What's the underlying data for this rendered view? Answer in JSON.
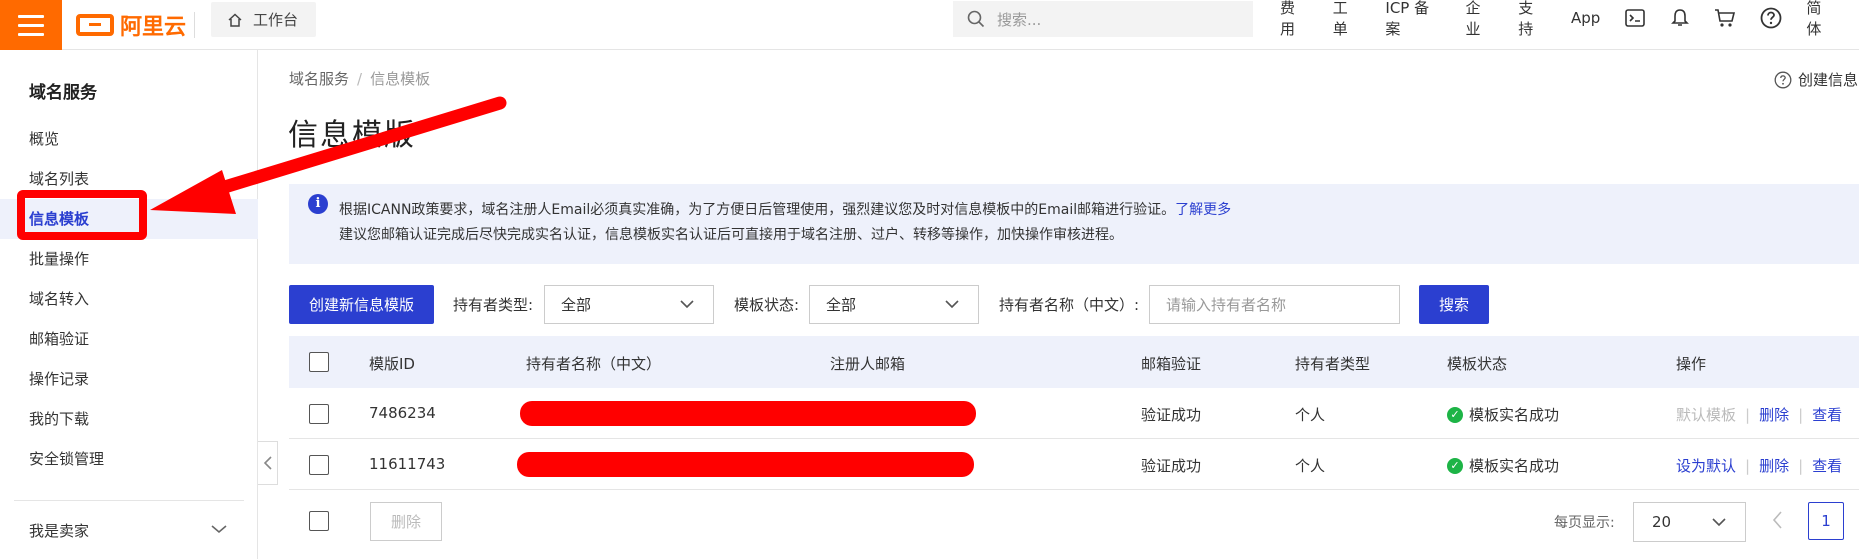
{
  "topbar": {
    "logo_text": "阿里云",
    "workbench_label": "工作台",
    "search_placeholder": "搜索...",
    "nav": [
      "费用",
      "工单",
      "ICP 备案",
      "企业",
      "支持",
      "App"
    ],
    "lang_label": "简体",
    "icons": [
      "terminal-icon",
      "bell-icon",
      "cart-icon",
      "help-icon"
    ]
  },
  "sidebar": {
    "title": "域名服务",
    "items": [
      {
        "label": "概览",
        "active": false
      },
      {
        "label": "域名列表",
        "active": false
      },
      {
        "label": "信息模板",
        "active": true
      },
      {
        "label": "批量操作",
        "active": false
      },
      {
        "label": "域名转入",
        "active": false
      },
      {
        "label": "邮箱验证",
        "active": false
      },
      {
        "label": "操作记录",
        "active": false
      },
      {
        "label": "我的下载",
        "active": false
      },
      {
        "label": "安全锁管理",
        "active": false
      }
    ],
    "seller_label": "我是卖家"
  },
  "breadcrumb": {
    "parent": "域名服务",
    "separator": "/",
    "current": "信息模板"
  },
  "help_link": "创建信息",
  "page_title": "信息模版",
  "notice": {
    "line1": "根据ICANN政策要求，域名注册人Email必须真实准确，为了方便日后管理使用，强烈建议您及时对信息模板中的Email邮箱进行验证。",
    "more_link": "了解更多",
    "line2": "建议您邮箱认证完成后尽快完成实名认证，信息模板实名认证后可直接用于域名注册、过户、转移等操作，加快操作审核进程。"
  },
  "filters": {
    "create_button": "创建新信息模版",
    "holder_type_label": "持有者类型:",
    "holder_type_value": "全部",
    "status_label": "模板状态:",
    "status_value": "全部",
    "holder_name_label": "持有者名称（中文）:",
    "holder_name_placeholder": "请输入持有者名称",
    "search_button": "搜索"
  },
  "table": {
    "columns": [
      "模版ID",
      "持有者名称（中文）",
      "注册人邮箱",
      "邮箱验证",
      "持有者类型",
      "模板状态",
      "操作"
    ],
    "rows": [
      {
        "id": "7486234",
        "email_verify": "验证成功",
        "holder_type": "个人",
        "status": "模板实名成功",
        "op_default": "默认模板",
        "op_default_enabled": false,
        "op_delete": "删除",
        "op_view": "查看"
      },
      {
        "id": "11611743",
        "email_verify": "验证成功",
        "holder_type": "个人",
        "status": "模板实名成功",
        "op_default": "设为默认",
        "op_default_enabled": true,
        "op_delete": "删除",
        "op_view": "查看"
      }
    ]
  },
  "footer": {
    "delete_button": "删除",
    "per_page_label": "每页显示:",
    "per_page_value": "20",
    "current_page": "1"
  },
  "colors": {
    "brand_orange": "#ff6a00",
    "accent_blue": "#2b3fd0",
    "annotation_red": "#ff0000",
    "success_green": "#1db446"
  }
}
